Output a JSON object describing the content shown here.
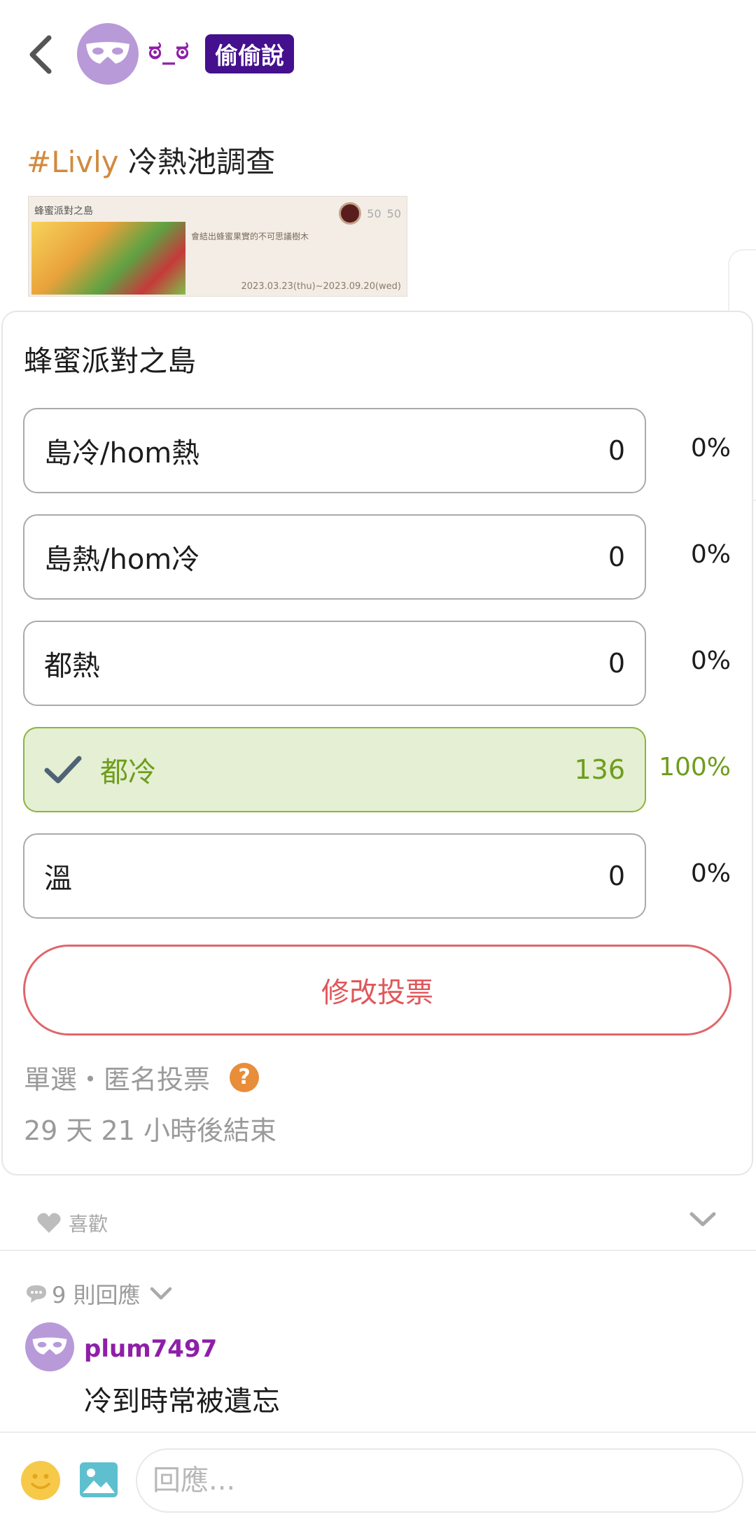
{
  "header": {
    "username": "ಠ_ಠ",
    "tag": "偷偷說"
  },
  "post": {
    "hashtag": "#Livly",
    "title": "冷熱池調查",
    "thumbnail": {
      "title": "蜂蜜派對之島",
      "desc": "會結出蜂蜜果實的不可思議樹木",
      "stats_a": "50",
      "stats_b": "50",
      "date": "2023.03.23(thu)~2023.09.20(wed)"
    }
  },
  "poll": {
    "title": "蜂蜜派對之島",
    "options": [
      {
        "label": "島冷/hom熱",
        "count": "0",
        "percent": "0%",
        "selected": false
      },
      {
        "label": "島熱/hom冷",
        "count": "0",
        "percent": "0%",
        "selected": false
      },
      {
        "label": "都熱",
        "count": "0",
        "percent": "0%",
        "selected": false
      },
      {
        "label": "都冷",
        "count": "136",
        "percent": "100%",
        "selected": true
      },
      {
        "label": "溫",
        "count": "0",
        "percent": "0%",
        "selected": false
      }
    ],
    "change_vote_label": "修改投票",
    "meta": "單選・匿名投票",
    "help_symbol": "?",
    "ends_in": "29 天 21 小時後結束"
  },
  "actions": {
    "like_label": "喜歡"
  },
  "comments": {
    "count_label": "9 則回應",
    "items": [
      {
        "user": "plum7497",
        "text": "冷到時常被遺忘"
      }
    ]
  },
  "composer": {
    "placeholder": "回應..."
  },
  "colors": {
    "brand_purple": "#8e1fa8",
    "badge_bg": "#44108d",
    "hashtag": "#d18a3e",
    "selected_green": "#6f9d1c",
    "change_vote_red": "#e0575b"
  }
}
